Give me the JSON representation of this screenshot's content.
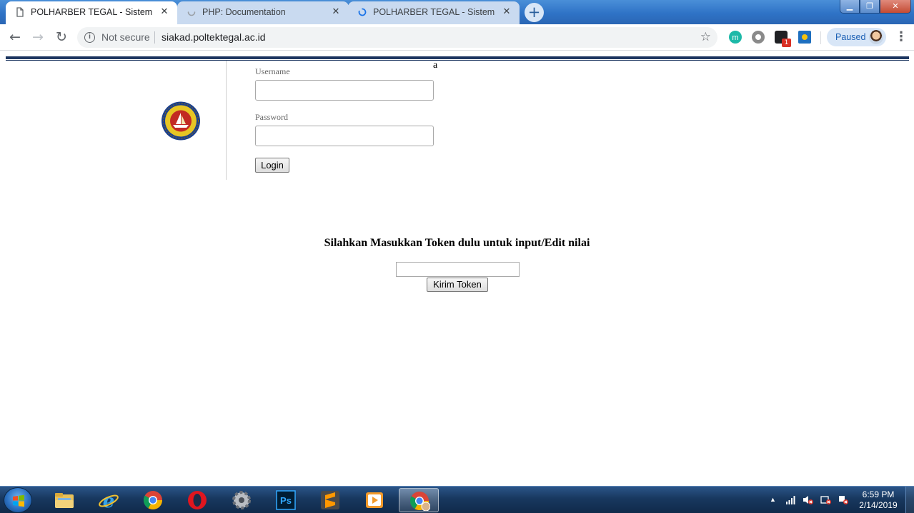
{
  "browser": {
    "tabs": [
      {
        "title": "POLHARBER TEGAL - Sistem Informasi",
        "icon": "page-icon",
        "active": true
      },
      {
        "title": "PHP: Documentation",
        "icon": "loading-spinner-icon",
        "active": false
      },
      {
        "title": "POLHARBER TEGAL - Sistem Informasi",
        "icon": "loading-spinner-icon",
        "active": false
      }
    ],
    "new_tab_label": "+",
    "address": {
      "security_label": "Not secure",
      "url": "siakad.poltektegal.ac.id"
    },
    "extension_badge": "1",
    "profile_label": "Paused",
    "colors": {
      "frame": "#2f73c6",
      "inactive_tab": "#c9daf0",
      "accent": "#1a73e8"
    }
  },
  "page": {
    "stray_text": "a",
    "login": {
      "username_label": "Username",
      "password_label": "Password",
      "login_button": "Login"
    },
    "token": {
      "heading": "Silahkan Masukkan Token dulu untuk input/Edit nilai",
      "submit_button": "Kirim Token"
    },
    "colors": {
      "rule": "#1c3560"
    }
  },
  "taskbar": {
    "apps": [
      "explorer-icon",
      "internet-explorer-icon",
      "chrome-icon",
      "opera-icon",
      "settings-icon",
      "photoshop-icon",
      "sublime-text-icon",
      "media-player-icon",
      "chrome-icon"
    ],
    "photoshop_label": "Ps",
    "clock": {
      "time": "6:59 PM",
      "date": "2/14/2019"
    }
  }
}
